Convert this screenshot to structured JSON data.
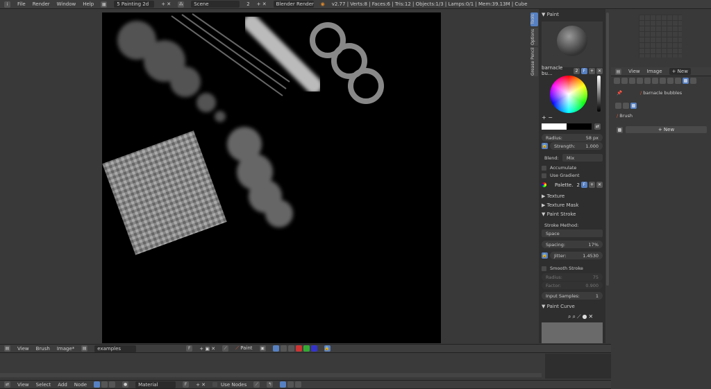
{
  "topbar": {
    "menus": [
      "File",
      "Render",
      "Window",
      "Help"
    ],
    "screen": "5 Painting 2d",
    "scene": "Scene",
    "scene_users": "2",
    "engine": "Blender Render",
    "stats": "v2.77 | Verts:8 | Faces:6 | Tris:12 | Objects:1/3 | Lamps:0/1 | Mem:39.13M | Cube"
  },
  "tool_tabs": [
    "Tools",
    "Options",
    "Grease Pencil"
  ],
  "paint_panel": {
    "title": "Paint",
    "brush_name": "barnacle bu...",
    "brush_users": "2",
    "fake_user": "F",
    "radius_label": "Radius:",
    "radius_value": "58 px",
    "strength_label": "Strength:",
    "strength_value": "1.000",
    "blend_label": "Blend:",
    "blend_value": "Mix",
    "accumulate": "Accumulate",
    "use_gradient": "Use Gradient",
    "palette_name": "Palette.",
    "palette_users": "2",
    "primary_color": "#ffffff",
    "secondary_color": "#000000"
  },
  "sections": {
    "texture": "Texture",
    "texture_mask": "Texture Mask",
    "paint_stroke": "Paint Stroke",
    "paint_curve": "Paint Curve"
  },
  "stroke": {
    "method_label": "Stroke Method:",
    "method_value": "Space",
    "spacing_label": "Spacing:",
    "spacing_value": "17%",
    "jitter_label": "Jitter:",
    "jitter_value": "1.4530",
    "smooth_stroke": "Smooth Stroke",
    "radius_label": "Radius:",
    "radius_value": "75",
    "factor_label": "Factor:",
    "factor_value": "0.900",
    "input_samples_label": "Input Samples:",
    "input_samples_value": "1"
  },
  "properties": {
    "menus": [
      "View",
      "Image"
    ],
    "new_label": "New",
    "brush_name": "barnacle bubbles",
    "brush_label": "Brush",
    "texture_new": "New"
  },
  "image_editor_header": {
    "menus": [
      "View",
      "Brush",
      "Image*"
    ],
    "image_name": "examples",
    "fake_user": "F",
    "mode": "Paint"
  },
  "node_header": {
    "menus": [
      "View",
      "Select",
      "Add",
      "Node"
    ],
    "material": "Material",
    "fake_user": "F",
    "use_nodes": "Use Nodes"
  }
}
